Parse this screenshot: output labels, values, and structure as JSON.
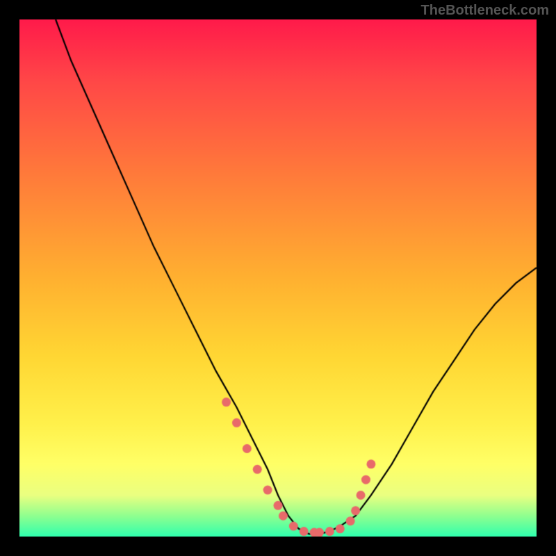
{
  "watermark": "TheBottleneck.com",
  "chart_data": {
    "type": "line",
    "title": "",
    "xlabel": "",
    "ylabel": "",
    "xlim": [
      0,
      100
    ],
    "ylim": [
      0,
      100
    ],
    "grid": false,
    "legend": false,
    "note": "Values estimated from pixel positions; chart has no numeric axis labels. y=0 is bottom (green/optimal), y=100 is top (red/severe bottleneck).",
    "series": [
      {
        "name": "bottleneck-curve",
        "x": [
          7,
          10,
          14,
          18,
          22,
          26,
          30,
          34,
          38,
          42,
          45,
          48,
          50,
          52,
          54,
          56,
          58,
          60,
          62,
          65,
          68,
          72,
          76,
          80,
          84,
          88,
          92,
          96,
          100
        ],
        "y": [
          100,
          92,
          83,
          74,
          65,
          56,
          48,
          40,
          32,
          25,
          19,
          13,
          8,
          4,
          1.5,
          0.5,
          0.5,
          1,
          2,
          4,
          8,
          14,
          21,
          28,
          34,
          40,
          45,
          49,
          52
        ]
      }
    ],
    "highlight_points": {
      "name": "near-optimal-dots",
      "note": "Salmon dots marking the near-zero-bottleneck region",
      "x": [
        40,
        42,
        44,
        46,
        48,
        50,
        51,
        53,
        55,
        57,
        58,
        60,
        62,
        64,
        65,
        66,
        67,
        68
      ],
      "y": [
        26,
        22,
        17,
        13,
        9,
        6,
        4,
        2,
        1,
        0.8,
        0.8,
        1,
        1.5,
        3,
        5,
        8,
        11,
        14
      ]
    },
    "gradient_stops": [
      {
        "pos": 0.0,
        "color": "#ff1a4a"
      },
      {
        "pos": 0.12,
        "color": "#ff4747"
      },
      {
        "pos": 0.3,
        "color": "#ff7a3a"
      },
      {
        "pos": 0.5,
        "color": "#ffb030"
      },
      {
        "pos": 0.65,
        "color": "#ffd633"
      },
      {
        "pos": 0.78,
        "color": "#fff04a"
      },
      {
        "pos": 0.86,
        "color": "#ffff66"
      },
      {
        "pos": 0.92,
        "color": "#eaff80"
      },
      {
        "pos": 0.96,
        "color": "#8fff8f"
      },
      {
        "pos": 1.0,
        "color": "#2fffad"
      }
    ],
    "colors": {
      "curve": "#000000",
      "dots": "#e86a6a",
      "background_frame": "#000000"
    }
  }
}
